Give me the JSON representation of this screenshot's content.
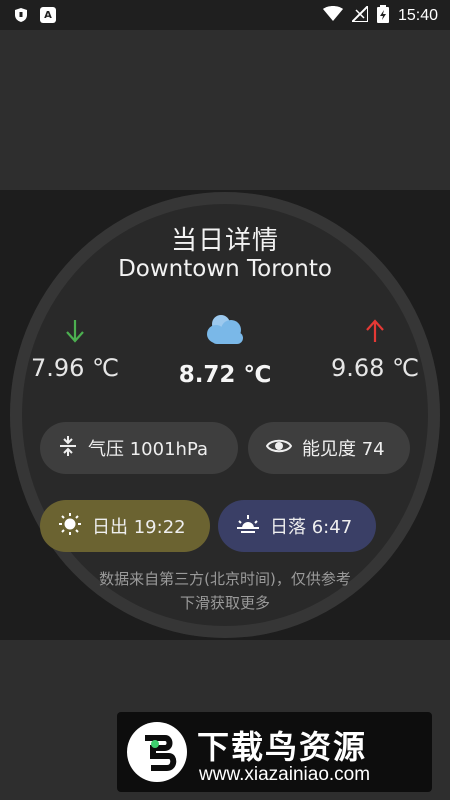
{
  "status_bar": {
    "time": "15:40",
    "left_icons": [
      "shield-icon",
      "a-icon"
    ],
    "right_icons": [
      "wifi-icon",
      "signal-icon",
      "battery-icon"
    ]
  },
  "weather_card": {
    "title": "当日详情",
    "location": "Downtown Toronto",
    "min_temp": "7.96 ℃",
    "current_temp": "8.72 ℃",
    "max_temp": "9.68 ℃",
    "pressure": "气压 1001hPa",
    "visibility": "能见度 74",
    "sunrise": "日出 19:22",
    "sunset": "日落 6:47",
    "note_line1": "数据来自第三方(北京时间)，仅供参考",
    "note_line2": "下滑获取更多",
    "colors": {
      "min_arrow": "#4caf50",
      "max_arrow": "#e53935",
      "sunrise_chip": "#6b6331",
      "sunset_chip": "#3a3f66",
      "cloud": "#7ab8e8"
    }
  },
  "watermark": {
    "brand": "下载鸟资源",
    "url": "www.xiazainiao.com"
  }
}
